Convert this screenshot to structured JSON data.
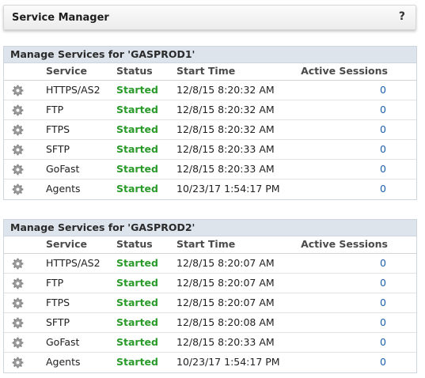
{
  "header": {
    "title": "Service Manager",
    "help": "?"
  },
  "columns": {
    "service": "Service",
    "status": "Status",
    "start_time": "Start Time",
    "active_sessions": "Active Sessions"
  },
  "panels": [
    {
      "title": "Manage Services for 'GASPROD1'",
      "rows": [
        {
          "service": "HTTPS/AS2",
          "status": "Started",
          "start_time": "12/8/15 8:20:32 AM",
          "sessions": "0"
        },
        {
          "service": "FTP",
          "status": "Started",
          "start_time": "12/8/15 8:20:32 AM",
          "sessions": "0"
        },
        {
          "service": "FTPS",
          "status": "Started",
          "start_time": "12/8/15 8:20:32 AM",
          "sessions": "0"
        },
        {
          "service": "SFTP",
          "status": "Started",
          "start_time": "12/8/15 8:20:33 AM",
          "sessions": "0"
        },
        {
          "service": "GoFast",
          "status": "Started",
          "start_time": "12/8/15 8:20:33 AM",
          "sessions": "0"
        },
        {
          "service": "Agents",
          "status": "Started",
          "start_time": "10/23/17 1:54:17 PM",
          "sessions": "0"
        }
      ]
    },
    {
      "title": "Manage Services for 'GASPROD2'",
      "rows": [
        {
          "service": "HTTPS/AS2",
          "status": "Started",
          "start_time": "12/8/15 8:20:07 AM",
          "sessions": "0"
        },
        {
          "service": "FTP",
          "status": "Started",
          "start_time": "12/8/15 8:20:07 AM",
          "sessions": "0"
        },
        {
          "service": "FTPS",
          "status": "Started",
          "start_time": "12/8/15 8:20:07 AM",
          "sessions": "0"
        },
        {
          "service": "SFTP",
          "status": "Started",
          "start_time": "12/8/15 8:20:08 AM",
          "sessions": "0"
        },
        {
          "service": "GoFast",
          "status": "Started",
          "start_time": "12/8/15 8:20:33 AM",
          "sessions": "0"
        },
        {
          "service": "Agents",
          "status": "Started",
          "start_time": "10/23/17 1:54:17 PM",
          "sessions": "0"
        }
      ]
    }
  ],
  "icons": {
    "row_action": "gear-icon",
    "help": "help-icon"
  },
  "colors": {
    "status_started": "#2a9b2a",
    "sessions_link": "#1f5fa8",
    "panel_header_bg": "#dde4ec"
  }
}
